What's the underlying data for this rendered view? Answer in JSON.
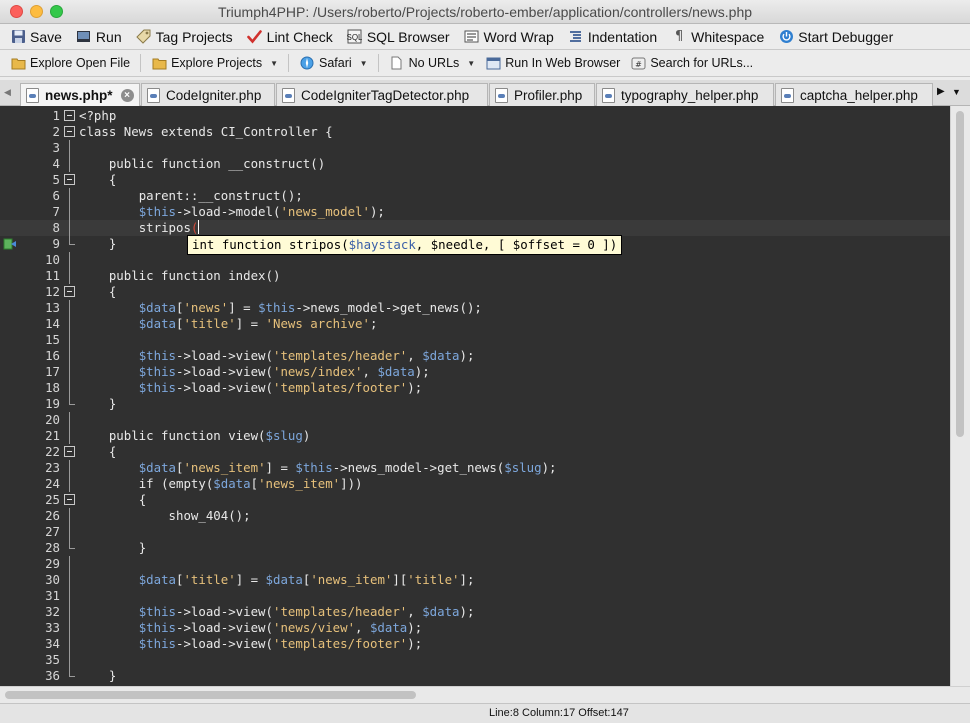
{
  "window": {
    "title": "Triumph4PHP: /Users/roberto/Projects/roberto-ember/application/controllers/news.php"
  },
  "toolbar_main": {
    "save": "Save",
    "run": "Run",
    "tag_projects": "Tag Projects",
    "lint_check": "Lint Check",
    "sql_browser": "SQL Browser",
    "word_wrap": "Word Wrap",
    "indentation": "Indentation",
    "whitespace": "Whitespace",
    "start_debugger": "Start Debugger"
  },
  "toolbar_secondary": {
    "explore_open_file": "Explore Open File",
    "explore_projects": "Explore Projects",
    "browser_select": "Safari",
    "url_select": "No URLs",
    "run_in_web_browser": "Run In Web Browser",
    "search_for_urls": "Search for URLs..."
  },
  "tabs": [
    {
      "label": "news.php*",
      "active": true
    },
    {
      "label": "CodeIgniter.php"
    },
    {
      "label": "CodeIgniterTagDetector.php"
    },
    {
      "label": "Profiler.php"
    },
    {
      "label": "typography_helper.php"
    },
    {
      "label": "captcha_helper.php"
    }
  ],
  "editor": {
    "line_numbers": [
      "1",
      "2",
      "3",
      "4",
      "5",
      "6",
      "7",
      "8",
      "9",
      "10",
      "11",
      "12",
      "13",
      "14",
      "15",
      "16",
      "17",
      "18",
      "19",
      "20",
      "21",
      "22",
      "23",
      "24",
      "25",
      "26",
      "27",
      "28",
      "29",
      "30",
      "31",
      "32",
      "33",
      "34",
      "35",
      "36"
    ],
    "code": {
      "l1": "<?php",
      "l2": "class News extends CI_Controller {",
      "l4": "public function __construct()",
      "l5": "{",
      "l6": "parent::__construct();",
      "l7a": "$this",
      "l7b": "->load->model(",
      "l7c": "'news_model'",
      "l7d": ");",
      "l8": "stripos",
      "l8b": "(",
      "l9": "}",
      "l11": "public function index()",
      "l12": "{",
      "l13a": "$data",
      "l13b": "[",
      "l13c": "'news'",
      "l13d": "] = ",
      "l13e": "$this",
      "l13f": "->news_model->get_news();",
      "l14a": "$data",
      "l14b": "[",
      "l14c": "'title'",
      "l14d": "] = ",
      "l14e": "'News archive'",
      "l14f": ";",
      "l16a": "$this",
      "l16b": "->load->view(",
      "l16c": "'templates/header'",
      "l16d": ", ",
      "l16e": "$data",
      "l16f": ");",
      "l17a": "$this",
      "l17b": "->load->view(",
      "l17c": "'news/index'",
      "l17d": ", ",
      "l17e": "$data",
      "l17f": ");",
      "l18a": "$this",
      "l18b": "->load->view(",
      "l18c": "'templates/footer'",
      "l18d": ");",
      "l19": "}",
      "l21a": "public function view(",
      "l21b": "$slug",
      "l21c": ")",
      "l22": "{",
      "l23a": "$data",
      "l23b": "[",
      "l23c": "'news_item'",
      "l23d": "] = ",
      "l23e": "$this",
      "l23f": "->news_model->get_news(",
      "l23g": "$slug",
      "l23h": ");",
      "l24a": "if (empty(",
      "l24b": "$data",
      "l24c": "[",
      "l24d": "'news_item'",
      "l24e": "]))",
      "l25": "{",
      "l26": "show_404();",
      "l28": "}",
      "l30a": "$data",
      "l30b": "[",
      "l30c": "'title'",
      "l30d": "] = ",
      "l30e": "$data",
      "l30f": "[",
      "l30g": "'news_item'",
      "l30h": "][",
      "l30i": "'title'",
      "l30j": "];",
      "l32a": "$this",
      "l32b": "->load->view(",
      "l32c": "'templates/header'",
      "l32d": ", ",
      "l32e": "$data",
      "l32f": ");",
      "l33a": "$this",
      "l33b": "->load->view(",
      "l33c": "'news/view'",
      "l33d": ", ",
      "l33e": "$data",
      "l33f": ");",
      "l34a": "$this",
      "l34b": "->load->view(",
      "l34c": "'templates/footer'",
      "l34d": ");",
      "l36": "}"
    },
    "tooltip": {
      "a": "int function stripos(",
      "b": "$haystack",
      "c": ", $needle, [ $offset = 0 ])"
    }
  },
  "status": {
    "position": "Line:8 Column:17 Offset:147"
  },
  "colors": {
    "editor_bg": "#303030",
    "variable": "#7da7dc",
    "string": "#e6c07b",
    "tooltip_bg": "#fffbd6"
  }
}
